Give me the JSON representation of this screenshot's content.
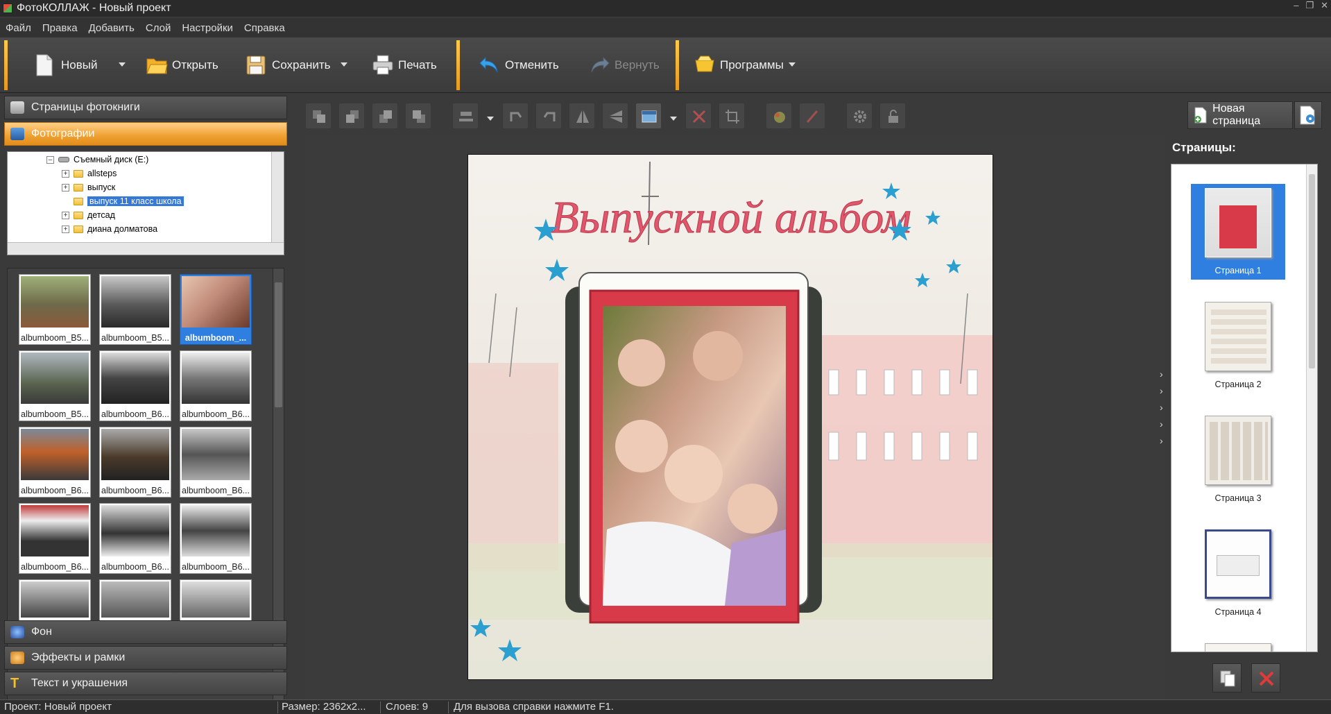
{
  "window": {
    "title": "ФотоКОЛЛАЖ - Новый проект"
  },
  "menu": [
    "Файл",
    "Правка",
    "Добавить",
    "Слой",
    "Настройки",
    "Справка"
  ],
  "toolbar": {
    "new_label": "Новый",
    "open_label": "Открыть",
    "save_label": "Сохранить",
    "print_label": "Печать",
    "undo_label": "Отменить",
    "redo_label": "Вернуть",
    "programs_label": "Программы"
  },
  "left_panel": {
    "book_pages_header": "Страницы фотокниги",
    "photos_header": "Фотографии",
    "background_header": "Фон",
    "effects_header": "Эффекты и рамки",
    "text_header": "Текст и украшения"
  },
  "tree": {
    "drive": "Съемный диск (E:)",
    "folders": [
      "allsteps",
      "выпуск",
      "выпуск 11 класс школа",
      "детсад",
      "диана долматова"
    ],
    "selected_folder": "выпуск 11 класс школа"
  },
  "thumbnails": [
    {
      "caption": "albumboom_B5...",
      "selected": false
    },
    {
      "caption": "albumboom_B5...",
      "selected": false
    },
    {
      "caption": "albumboom_...",
      "selected": true
    },
    {
      "caption": "albumboom_B5...",
      "selected": false
    },
    {
      "caption": "albumboom_B6...",
      "selected": false
    },
    {
      "caption": "albumboom_B6...",
      "selected": false
    },
    {
      "caption": "albumboom_B6...",
      "selected": false
    },
    {
      "caption": "albumboom_B6...",
      "selected": false
    },
    {
      "caption": "albumboom_B6...",
      "selected": false
    },
    {
      "caption": "albumboom_B6...",
      "selected": false
    },
    {
      "caption": "albumboom_B6...",
      "selected": false
    },
    {
      "caption": "albumboom_B6...",
      "selected": false
    }
  ],
  "page_tools": {
    "new_page_label": "Новая страница"
  },
  "canvas": {
    "album_title": "Выпускной альбом"
  },
  "pages_panel": {
    "label": "Страницы:",
    "pages": [
      "Страница 1",
      "Страница 2",
      "Страница 3",
      "Страница 4"
    ],
    "selected_index": 0
  },
  "status": {
    "project": "Проект:  Новый проект",
    "size": "Размер:  2362x2...",
    "layers": "Слоев:  9",
    "hint": "Для вызова справки нажмите F1."
  },
  "colors": {
    "accent_orange": "#f0a030",
    "selection_blue": "#2f7fe0",
    "frame_red": "#d83a4a",
    "title_pink": "#e0566a",
    "star_blue": "#2a9fd0"
  }
}
